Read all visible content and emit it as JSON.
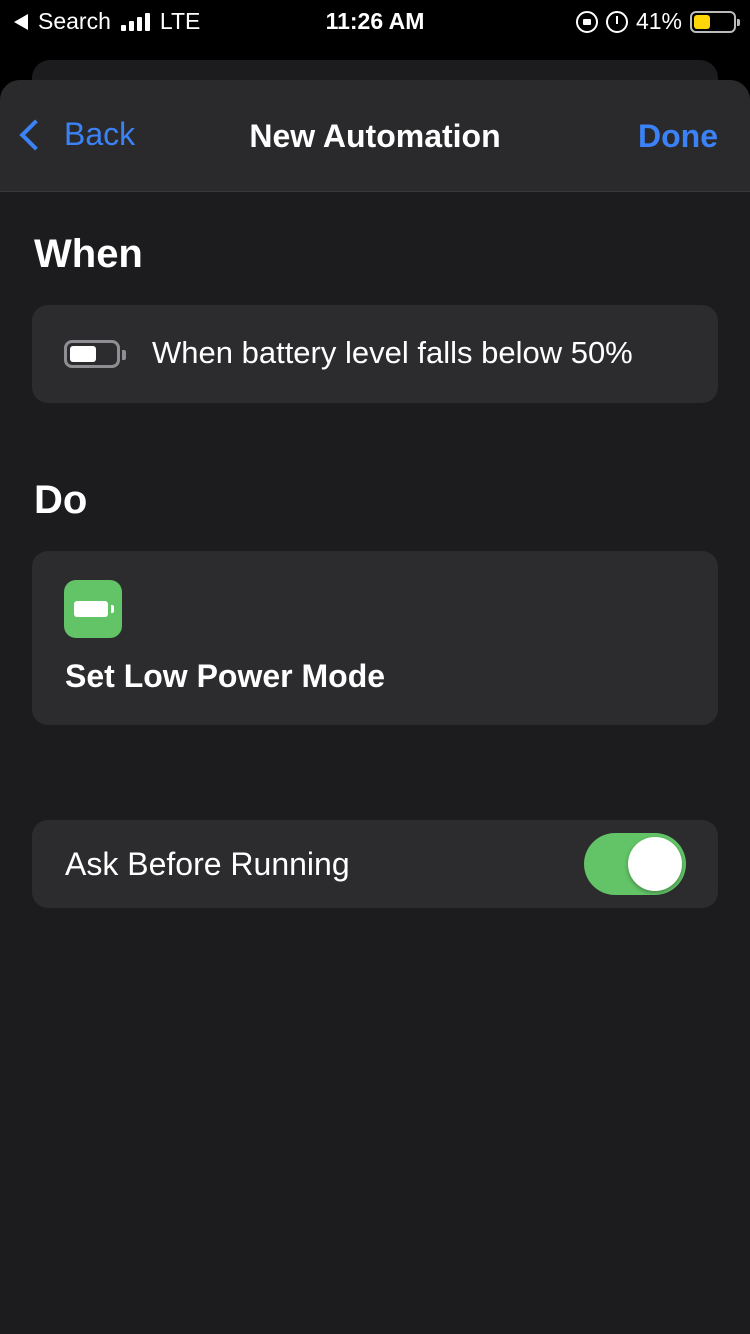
{
  "status_bar": {
    "back_app": "Search",
    "carrier": "LTE",
    "time": "11:26 AM",
    "battery_percent": "41%",
    "battery_level": 0.41,
    "battery_color": "#ffd60a"
  },
  "navbar": {
    "back_label": "Back",
    "title": "New Automation",
    "done_label": "Done"
  },
  "when": {
    "heading": "When",
    "trigger_text": "When battery level falls below 50%",
    "trigger_icon": "battery-icon"
  },
  "do": {
    "heading": "Do",
    "action_label": "Set Low Power Mode",
    "action_icon": "low-power-battery-icon",
    "action_icon_color": "#62c466"
  },
  "ask_before_running": {
    "label": "Ask Before Running",
    "enabled": true
  },
  "colors": {
    "accent": "#3b82f6",
    "toggle_on": "#62c466",
    "background": "#1c1c1e",
    "card": "#2c2c2e"
  }
}
